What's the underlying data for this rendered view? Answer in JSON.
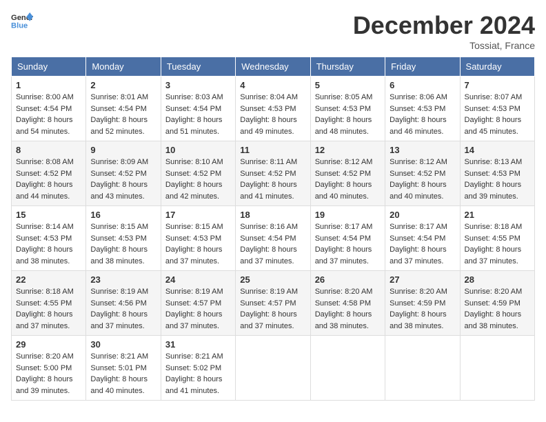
{
  "header": {
    "logo_general": "General",
    "logo_blue": "Blue",
    "month_title": "December 2024",
    "location": "Tossiat, France"
  },
  "weekdays": [
    "Sunday",
    "Monday",
    "Tuesday",
    "Wednesday",
    "Thursday",
    "Friday",
    "Saturday"
  ],
  "weeks": [
    [
      {
        "day": "1",
        "sunrise": "8:00 AM",
        "sunset": "4:54 PM",
        "daylight": "8 hours and 54 minutes."
      },
      {
        "day": "2",
        "sunrise": "8:01 AM",
        "sunset": "4:54 PM",
        "daylight": "8 hours and 52 minutes."
      },
      {
        "day": "3",
        "sunrise": "8:03 AM",
        "sunset": "4:54 PM",
        "daylight": "8 hours and 51 minutes."
      },
      {
        "day": "4",
        "sunrise": "8:04 AM",
        "sunset": "4:53 PM",
        "daylight": "8 hours and 49 minutes."
      },
      {
        "day": "5",
        "sunrise": "8:05 AM",
        "sunset": "4:53 PM",
        "daylight": "8 hours and 48 minutes."
      },
      {
        "day": "6",
        "sunrise": "8:06 AM",
        "sunset": "4:53 PM",
        "daylight": "8 hours and 46 minutes."
      },
      {
        "day": "7",
        "sunrise": "8:07 AM",
        "sunset": "4:53 PM",
        "daylight": "8 hours and 45 minutes."
      }
    ],
    [
      {
        "day": "8",
        "sunrise": "8:08 AM",
        "sunset": "4:52 PM",
        "daylight": "8 hours and 44 minutes."
      },
      {
        "day": "9",
        "sunrise": "8:09 AM",
        "sunset": "4:52 PM",
        "daylight": "8 hours and 43 minutes."
      },
      {
        "day": "10",
        "sunrise": "8:10 AM",
        "sunset": "4:52 PM",
        "daylight": "8 hours and 42 minutes."
      },
      {
        "day": "11",
        "sunrise": "8:11 AM",
        "sunset": "4:52 PM",
        "daylight": "8 hours and 41 minutes."
      },
      {
        "day": "12",
        "sunrise": "8:12 AM",
        "sunset": "4:52 PM",
        "daylight": "8 hours and 40 minutes."
      },
      {
        "day": "13",
        "sunrise": "8:12 AM",
        "sunset": "4:52 PM",
        "daylight": "8 hours and 40 minutes."
      },
      {
        "day": "14",
        "sunrise": "8:13 AM",
        "sunset": "4:53 PM",
        "daylight": "8 hours and 39 minutes."
      }
    ],
    [
      {
        "day": "15",
        "sunrise": "8:14 AM",
        "sunset": "4:53 PM",
        "daylight": "8 hours and 38 minutes."
      },
      {
        "day": "16",
        "sunrise": "8:15 AM",
        "sunset": "4:53 PM",
        "daylight": "8 hours and 38 minutes."
      },
      {
        "day": "17",
        "sunrise": "8:15 AM",
        "sunset": "4:53 PM",
        "daylight": "8 hours and 37 minutes."
      },
      {
        "day": "18",
        "sunrise": "8:16 AM",
        "sunset": "4:54 PM",
        "daylight": "8 hours and 37 minutes."
      },
      {
        "day": "19",
        "sunrise": "8:17 AM",
        "sunset": "4:54 PM",
        "daylight": "8 hours and 37 minutes."
      },
      {
        "day": "20",
        "sunrise": "8:17 AM",
        "sunset": "4:54 PM",
        "daylight": "8 hours and 37 minutes."
      },
      {
        "day": "21",
        "sunrise": "8:18 AM",
        "sunset": "4:55 PM",
        "daylight": "8 hours and 37 minutes."
      }
    ],
    [
      {
        "day": "22",
        "sunrise": "8:18 AM",
        "sunset": "4:55 PM",
        "daylight": "8 hours and 37 minutes."
      },
      {
        "day": "23",
        "sunrise": "8:19 AM",
        "sunset": "4:56 PM",
        "daylight": "8 hours and 37 minutes."
      },
      {
        "day": "24",
        "sunrise": "8:19 AM",
        "sunset": "4:57 PM",
        "daylight": "8 hours and 37 minutes."
      },
      {
        "day": "25",
        "sunrise": "8:19 AM",
        "sunset": "4:57 PM",
        "daylight": "8 hours and 37 minutes."
      },
      {
        "day": "26",
        "sunrise": "8:20 AM",
        "sunset": "4:58 PM",
        "daylight": "8 hours and 38 minutes."
      },
      {
        "day": "27",
        "sunrise": "8:20 AM",
        "sunset": "4:59 PM",
        "daylight": "8 hours and 38 minutes."
      },
      {
        "day": "28",
        "sunrise": "8:20 AM",
        "sunset": "4:59 PM",
        "daylight": "8 hours and 38 minutes."
      }
    ],
    [
      {
        "day": "29",
        "sunrise": "8:20 AM",
        "sunset": "5:00 PM",
        "daylight": "8 hours and 39 minutes."
      },
      {
        "day": "30",
        "sunrise": "8:21 AM",
        "sunset": "5:01 PM",
        "daylight": "8 hours and 40 minutes."
      },
      {
        "day": "31",
        "sunrise": "8:21 AM",
        "sunset": "5:02 PM",
        "daylight": "8 hours and 41 minutes."
      },
      null,
      null,
      null,
      null
    ]
  ],
  "labels": {
    "sunrise": "Sunrise:",
    "sunset": "Sunset:",
    "daylight": "Daylight:"
  }
}
